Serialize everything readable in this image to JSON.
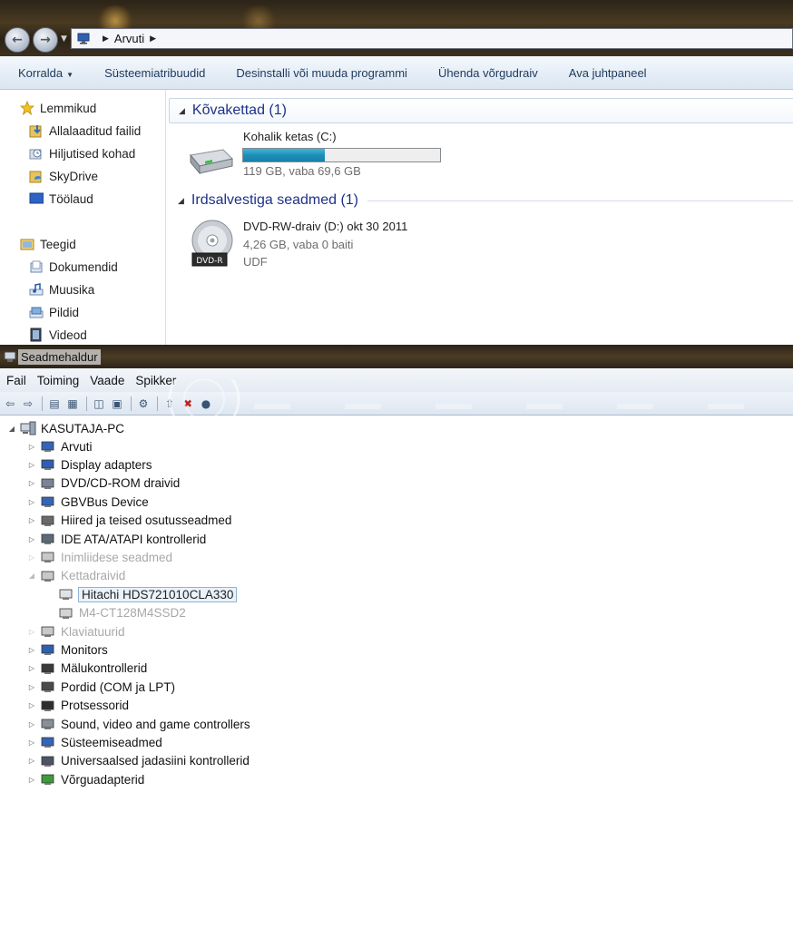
{
  "explorer": {
    "address": {
      "crumbs": [
        "Arvuti"
      ]
    },
    "toolbar": {
      "items": [
        "Korralda",
        "Süsteemiatribuudid",
        "Desinstalli või muuda programmi",
        "Ühenda võrgudraiv",
        "Ava juhtpaneel"
      ]
    },
    "nav_pane": {
      "favorites_header": "Lemmikud",
      "favorites": [
        "Allalaaditud failid",
        "Hiljutised kohad",
        "SkyDrive",
        "Töölaud"
      ],
      "libraries_header": "Teegid",
      "libraries": [
        "Dokumendid",
        "Muusika",
        "Pildid",
        "Videod"
      ]
    },
    "groups": {
      "hdd_header": "Kõvakettad (1)",
      "removable_header": "Irdsalvestiga seadmed (1)"
    },
    "drive_c": {
      "name": "Kohalik ketas (C:)",
      "space": "119 GB, vaba 69,6 GB",
      "used_fraction": 0.415
    },
    "drive_d": {
      "name": "DVD-RW-draiv (D:) okt 30 2011",
      "space": "4,26 GB, vaba 0 baiti",
      "fs": "UDF",
      "icon_label": "DVD-R"
    }
  },
  "device_manager": {
    "title": "Seadmehaldur",
    "menu": [
      "Fail",
      "Toiming",
      "Vaade",
      "Spikker"
    ],
    "tree": {
      "root": "KASUTAJA-PC",
      "categories": [
        "Arvuti",
        "Display adapters",
        "DVD/CD-ROM draivid",
        "GBVBus Device",
        "Hiired ja teised osutusseadmed",
        "IDE ATA/ATAPI kontrollerid",
        "Inimliidese seadmed",
        "Kettadraivid",
        "Klaviatuurid",
        "Monitors",
        "Mälukontrollerid",
        "Pordid (COM ja LPT)",
        "Protsessorid",
        "Sound, video and game controllers",
        "Süsteemiseadmed",
        "Universaalsed jadasiini kontrollerid",
        "Võrguadapterid"
      ],
      "disk_drives": [
        "Hitachi HDS721010CLA330",
        "M4-CT128M4SSD2"
      ]
    }
  }
}
